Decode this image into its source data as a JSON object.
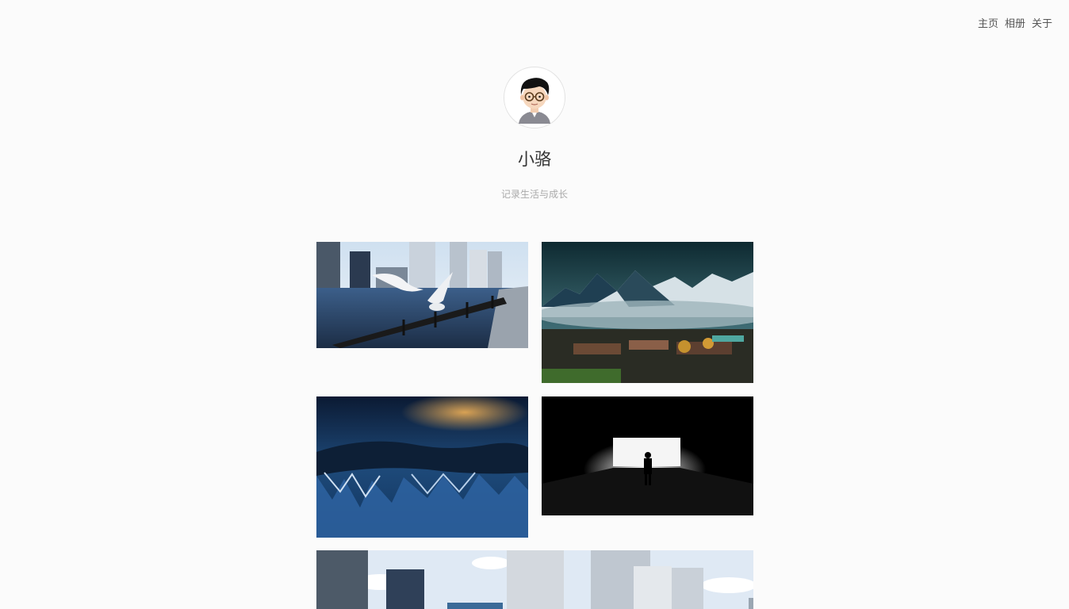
{
  "nav": {
    "home": "主页",
    "album": "相册",
    "about": "关于"
  },
  "profile": {
    "name": "小骆",
    "tagline": "记录生活与成长"
  },
  "photos": [
    {
      "subject": "seagulls-waterfront-city"
    },
    {
      "subject": "snow-mountains-village"
    },
    {
      "subject": "blue-ice-reflection"
    },
    {
      "subject": "tunnel-silhouette"
    },
    {
      "subject": "city-skyscrapers"
    }
  ],
  "colors": {
    "background": "#fbfbfb",
    "text": "#444444",
    "muted": "#aaaaaa"
  }
}
